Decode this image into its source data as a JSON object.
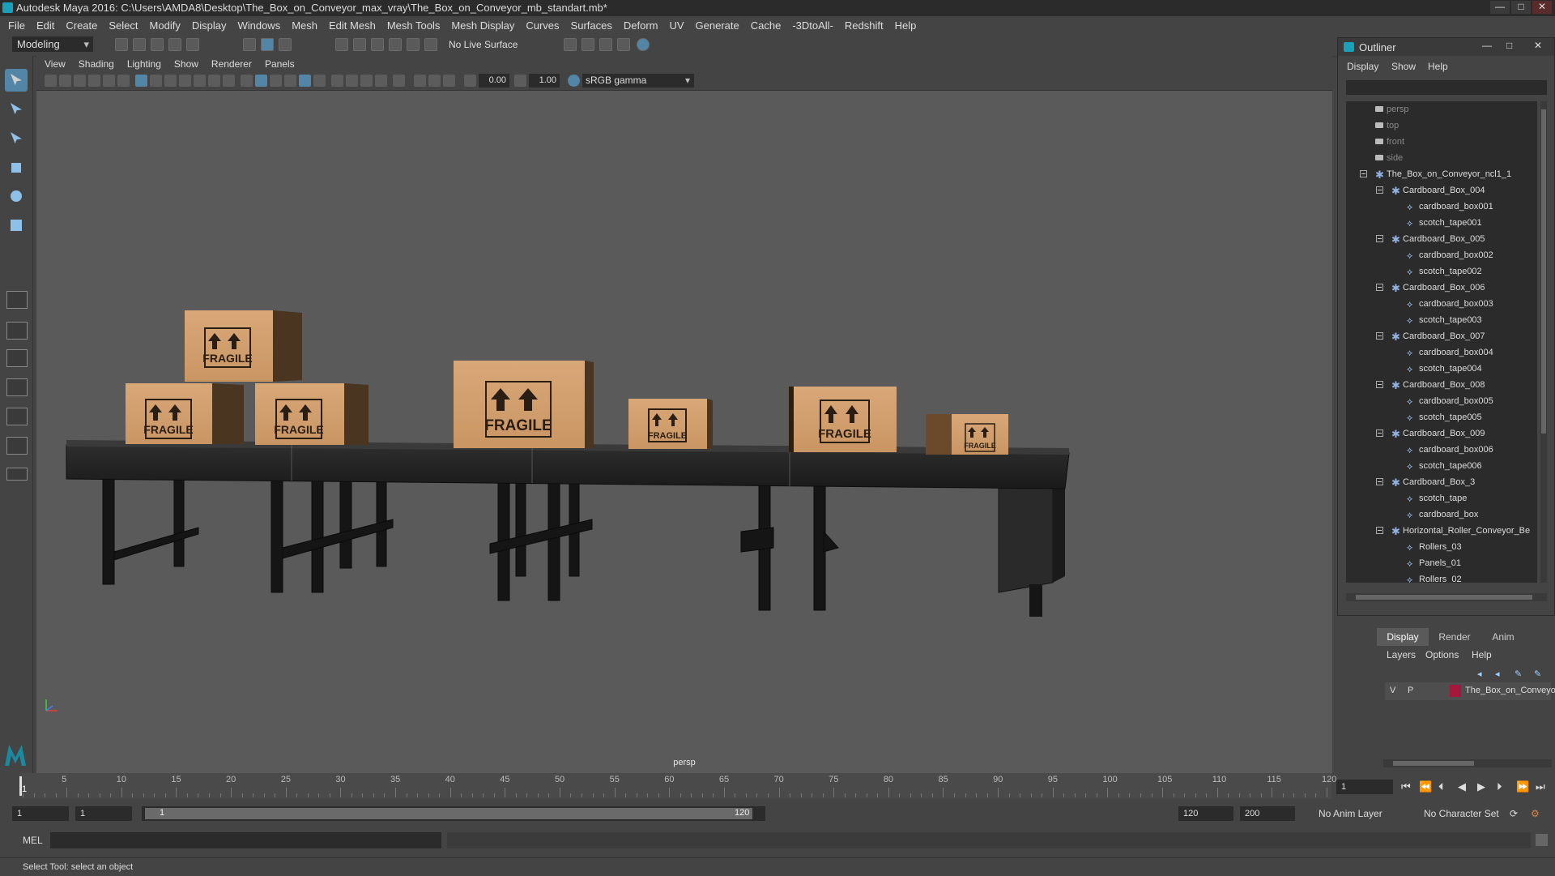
{
  "window": {
    "title": "Autodesk Maya 2016: C:\\Users\\AMDA8\\Desktop\\The_Box_on_Conveyor_max_vray\\The_Box_on_Conveyor_mb_standart.mb*",
    "minimize": "—",
    "maximize": "□",
    "close": "✕"
  },
  "menubar": [
    "File",
    "Edit",
    "Create",
    "Select",
    "Modify",
    "Display",
    "Windows",
    "Mesh",
    "Edit Mesh",
    "Mesh Tools",
    "Mesh Display",
    "Curves",
    "Surfaces",
    "Deform",
    "UV",
    "Generate",
    "Cache",
    "-3DtoAll-",
    "Redshift",
    "Help"
  ],
  "statusline": {
    "mode": "Modeling",
    "live_surface": "No Live Surface"
  },
  "viewport": {
    "menu": [
      "View",
      "Shading",
      "Lighting",
      "Show",
      "Renderer",
      "Panels"
    ],
    "exposure": "0.00",
    "gamma": "1.00",
    "color_space": "sRGB gamma",
    "camera": "persp",
    "box_label": "FRAGILE"
  },
  "outliner": {
    "title": "Outliner",
    "menu": [
      "Display",
      "Show",
      "Help"
    ],
    "items": [
      {
        "label": "persp",
        "level": 0,
        "type": "camera",
        "dim": true
      },
      {
        "label": "top",
        "level": 0,
        "type": "camera",
        "dim": true
      },
      {
        "label": "front",
        "level": 0,
        "type": "camera",
        "dim": true
      },
      {
        "label": "side",
        "level": 0,
        "type": "camera",
        "dim": true
      },
      {
        "label": "The_Box_on_Conveyor_ncl1_1",
        "level": 0,
        "type": "group",
        "expanded": true
      },
      {
        "label": "Cardboard_Box_004",
        "level": 1,
        "type": "group",
        "expanded": true
      },
      {
        "label": "cardboard_box001",
        "level": 2,
        "type": "mesh"
      },
      {
        "label": "scotch_tape001",
        "level": 2,
        "type": "mesh"
      },
      {
        "label": "Cardboard_Box_005",
        "level": 1,
        "type": "group",
        "expanded": true
      },
      {
        "label": "cardboard_box002",
        "level": 2,
        "type": "mesh"
      },
      {
        "label": "scotch_tape002",
        "level": 2,
        "type": "mesh"
      },
      {
        "label": "Cardboard_Box_006",
        "level": 1,
        "type": "group",
        "expanded": true
      },
      {
        "label": "cardboard_box003",
        "level": 2,
        "type": "mesh"
      },
      {
        "label": "scotch_tape003",
        "level": 2,
        "type": "mesh"
      },
      {
        "label": "Cardboard_Box_007",
        "level": 1,
        "type": "group",
        "expanded": true
      },
      {
        "label": "cardboard_box004",
        "level": 2,
        "type": "mesh"
      },
      {
        "label": "scotch_tape004",
        "level": 2,
        "type": "mesh"
      },
      {
        "label": "Cardboard_Box_008",
        "level": 1,
        "type": "group",
        "expanded": true
      },
      {
        "label": "cardboard_box005",
        "level": 2,
        "type": "mesh"
      },
      {
        "label": "scotch_tape005",
        "level": 2,
        "type": "mesh"
      },
      {
        "label": "Cardboard_Box_009",
        "level": 1,
        "type": "group",
        "expanded": true
      },
      {
        "label": "cardboard_box006",
        "level": 2,
        "type": "mesh"
      },
      {
        "label": "scotch_tape006",
        "level": 2,
        "type": "mesh"
      },
      {
        "label": "Cardboard_Box_3",
        "level": 1,
        "type": "group",
        "expanded": true
      },
      {
        "label": "scotch_tape",
        "level": 2,
        "type": "mesh"
      },
      {
        "label": "cardboard_box",
        "level": 2,
        "type": "mesh"
      },
      {
        "label": "Horizontal_Roller_Conveyor_Be",
        "level": 1,
        "type": "group",
        "expanded": true
      },
      {
        "label": "Rollers_03",
        "level": 2,
        "type": "mesh"
      },
      {
        "label": "Panels_01",
        "level": 2,
        "type": "mesh"
      },
      {
        "label": "Rollers_02",
        "level": 2,
        "type": "mesh"
      }
    ]
  },
  "layer_editor": {
    "tabs": [
      "Display",
      "Render",
      "Anim"
    ],
    "menu": [
      "Layers",
      "Options",
      "Help"
    ],
    "layer": {
      "v": "V",
      "p": "P",
      "name": "The_Box_on_Conveyor",
      "color": "#a3183c"
    }
  },
  "timeline": {
    "ticks": [
      5,
      10,
      15,
      20,
      25,
      30,
      35,
      40,
      45,
      50,
      55,
      60,
      65,
      70,
      75,
      80,
      85,
      90,
      95,
      100,
      105,
      110,
      115,
      120
    ],
    "current_frame": "1",
    "frame_field": "1"
  },
  "range": {
    "start": "1",
    "anim_start": "1",
    "range_start": "1",
    "range_end": "120",
    "end": "120",
    "anim_end": "200",
    "anim_layer": "No Anim Layer",
    "char_set": "No Character Set"
  },
  "cmdline": {
    "label": "MEL"
  },
  "helpline": {
    "text": "Select Tool: select an object"
  }
}
